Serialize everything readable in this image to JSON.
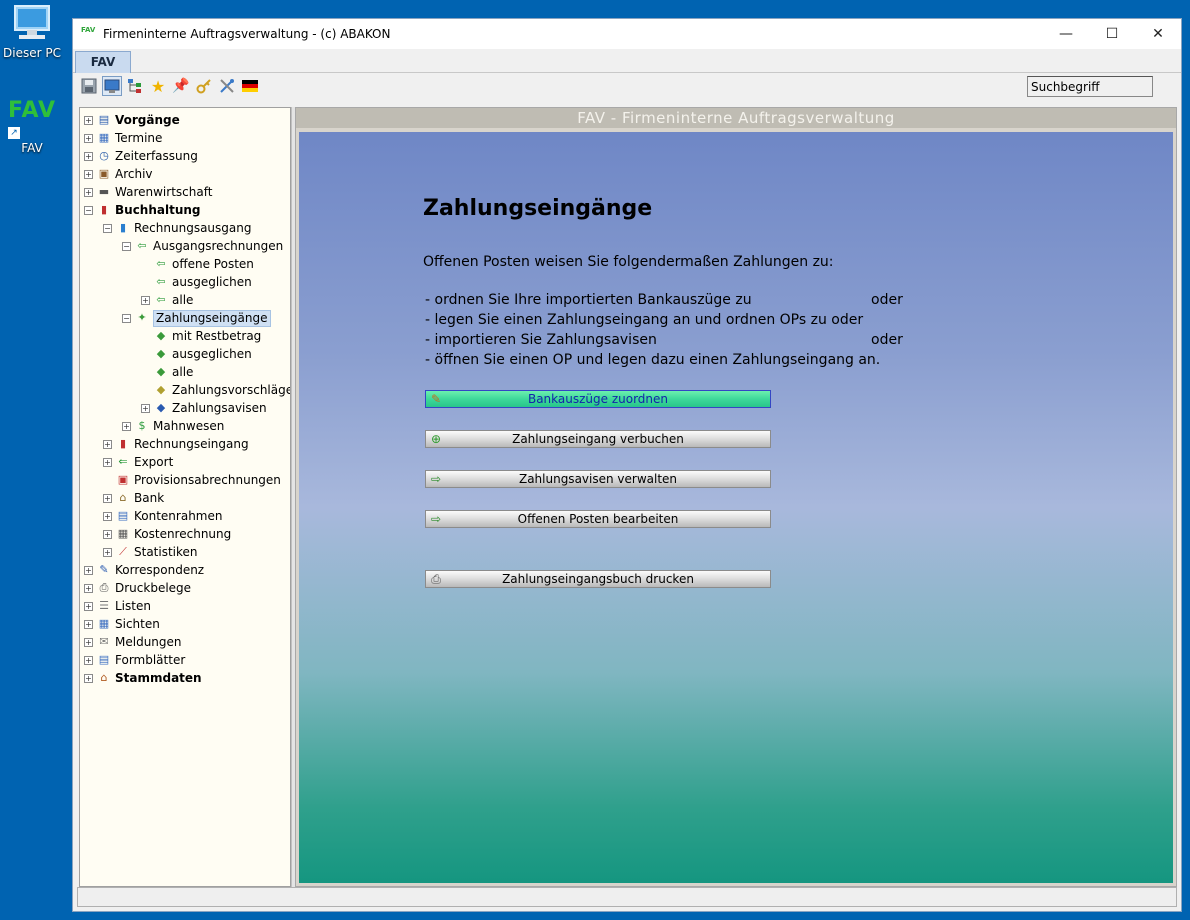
{
  "desktop": {
    "pc_label": "Dieser PC",
    "fav_logo": "FAV",
    "fav_label": "FAV"
  },
  "window": {
    "app_icon_text": "FAV",
    "title": "Firmeninterne Auftragsverwaltung - (c) ABAKON",
    "minimize": "—",
    "maximize": "☐",
    "close": "✕"
  },
  "tab": {
    "label": "FAV"
  },
  "toolbar": {
    "icons": [
      "save-icon",
      "monitor-icon",
      "tree-icon",
      "star-icon",
      "pin-icon",
      "key-icon",
      "tools-icon",
      "flag-de-icon"
    ],
    "search_value": "Suchbegriff"
  },
  "tree": [
    {
      "label": "Vorgänge",
      "bold": true,
      "level": 0,
      "exp": "+",
      "icon": "vorgaenge-icon",
      "glyph": "▤",
      "color": "#2d5fb0"
    },
    {
      "label": "Termine",
      "level": 0,
      "exp": "+",
      "icon": "calendar-icon",
      "glyph": "▦",
      "color": "#3a6dc0"
    },
    {
      "label": "Zeiterfassung",
      "level": 0,
      "exp": "+",
      "icon": "clock-icon",
      "glyph": "◷",
      "color": "#2a5ca8"
    },
    {
      "label": "Archiv",
      "level": 0,
      "exp": "+",
      "icon": "archive-icon",
      "glyph": "▣",
      "color": "#8a5a2a"
    },
    {
      "label": "Warenwirtschaft",
      "level": 0,
      "exp": "+",
      "icon": "truck-icon",
      "glyph": "▬",
      "color": "#555"
    },
    {
      "label": "Buchhaltung",
      "bold": true,
      "level": 0,
      "exp": "−",
      "icon": "chart-icon",
      "glyph": "▮",
      "color": "#c03030"
    },
    {
      "label": "Rechnungsausgang",
      "level": 1,
      "exp": "−",
      "icon": "invoice-out-icon",
      "glyph": "▮",
      "color": "#2a7fcf"
    },
    {
      "label": "Ausgangsrechnungen",
      "level": 2,
      "exp": "−",
      "icon": "invoice-list-icon",
      "glyph": "⇦",
      "color": "#2a9a3a"
    },
    {
      "label": "offene Posten",
      "level": 3,
      "exp": "",
      "icon": "open-items-icon",
      "glyph": "⇦",
      "color": "#2a9a3a"
    },
    {
      "label": "ausgeglichen",
      "level": 3,
      "exp": "",
      "icon": "balanced-icon",
      "glyph": "⇦",
      "color": "#2a9a3a"
    },
    {
      "label": "alle",
      "level": 3,
      "exp": "+",
      "icon": "all-icon",
      "glyph": "⇦",
      "color": "#2a9a3a"
    },
    {
      "label": "Zahlungseingänge",
      "level": 2,
      "exp": "−",
      "icon": "money-icon",
      "glyph": "✦",
      "color": "#3a9a3a",
      "selected": true
    },
    {
      "label": "mit Restbetrag",
      "level": 3,
      "exp": "",
      "icon": "money-rest-icon",
      "glyph": "◆",
      "color": "#3a9a3a"
    },
    {
      "label": "ausgeglichen",
      "level": 3,
      "exp": "",
      "icon": "money-balanced-icon",
      "glyph": "◆",
      "color": "#3a9a3a"
    },
    {
      "label": "alle",
      "level": 3,
      "exp": "",
      "icon": "money-all-icon",
      "glyph": "◆",
      "color": "#3a9a3a"
    },
    {
      "label": "Zahlungsvorschläge",
      "level": 3,
      "exp": "",
      "icon": "money-suggest-icon",
      "glyph": "◆",
      "color": "#b0a030"
    },
    {
      "label": "Zahlungsavisen",
      "level": 3,
      "exp": "+",
      "icon": "money-advice-icon",
      "glyph": "◆",
      "color": "#2a5ab0"
    },
    {
      "label": "Mahnwesen",
      "level": 2,
      "exp": "+",
      "icon": "dunning-icon",
      "glyph": "$",
      "color": "#2a9a3a"
    },
    {
      "label": "Rechnungseingang",
      "level": 1,
      "exp": "+",
      "icon": "invoice-in-icon",
      "glyph": "▮",
      "color": "#c03030"
    },
    {
      "label": "Export",
      "level": 1,
      "exp": "+",
      "icon": "export-icon",
      "glyph": "⇐",
      "color": "#2a9a3a"
    },
    {
      "label": "Provisionsabrechnungen",
      "level": 1,
      "exp": "",
      "icon": "commission-icon",
      "glyph": "▣",
      "color": "#c03030"
    },
    {
      "label": "Bank",
      "level": 1,
      "exp": "+",
      "icon": "bank-icon",
      "glyph": "⌂",
      "color": "#8a6a2a"
    },
    {
      "label": "Kontenrahmen",
      "level": 1,
      "exp": "+",
      "icon": "accounts-icon",
      "glyph": "▤",
      "color": "#3a6dc0"
    },
    {
      "label": "Kostenrechnung",
      "level": 1,
      "exp": "+",
      "icon": "calculator-icon",
      "glyph": "▦",
      "color": "#555"
    },
    {
      "label": "Statistiken",
      "level": 1,
      "exp": "+",
      "icon": "statistics-icon",
      "glyph": "⟋",
      "color": "#c03030"
    },
    {
      "label": "Korrespondenz",
      "level": 0,
      "exp": "+",
      "icon": "letter-icon",
      "glyph": "✎",
      "color": "#2a5ab0"
    },
    {
      "label": "Druckbelege",
      "level": 0,
      "exp": "+",
      "icon": "printer-icon",
      "glyph": "⎙",
      "color": "#555"
    },
    {
      "label": "Listen",
      "level": 0,
      "exp": "+",
      "icon": "list-icon",
      "glyph": "☰",
      "color": "#777"
    },
    {
      "label": "Sichten",
      "level": 0,
      "exp": "+",
      "icon": "views-icon",
      "glyph": "▦",
      "color": "#3a6dc0"
    },
    {
      "label": "Meldungen",
      "level": 0,
      "exp": "+",
      "icon": "mail-icon",
      "glyph": "✉",
      "color": "#777"
    },
    {
      "label": "Formblätter",
      "level": 0,
      "exp": "+",
      "icon": "forms-icon",
      "glyph": "▤",
      "color": "#3a6dc0"
    },
    {
      "label": "Stammdaten",
      "bold": true,
      "level": 0,
      "exp": "+",
      "icon": "house-icon",
      "glyph": "⌂",
      "color": "#b05a20"
    }
  ],
  "content": {
    "header": "FAV - Firmeninterne Auftragsverwaltung",
    "heading": "Zahlungseingänge",
    "intro": "Offenen Posten weisen Sie folgendermaßen Zahlungen zu:",
    "bullets": [
      "- ordnen Sie Ihre importierten Bankauszüge zu",
      "- legen Sie einen Zahlungseingang an und ordnen OPs zu oder",
      "- importieren Sie Zahlungsavisen",
      "- öffnen Sie einen OP und legen dazu einen Zahlungseingang an."
    ],
    "oder": "oder",
    "buttons": [
      {
        "label": "Bankauszüge zuordnen",
        "icon": "pencil-icon",
        "glyph": "✎",
        "color": "#c07020",
        "active": true
      },
      {
        "label": "Zahlungseingang verbuchen",
        "icon": "add-circle-icon",
        "glyph": "⊕",
        "color": "#2a9a2a"
      },
      {
        "label": "Zahlungsavisen verwalten",
        "icon": "advice-icon",
        "glyph": "⇨",
        "color": "#2a8a2a"
      },
      {
        "label": "Offenen Posten bearbeiten",
        "icon": "edit-items-icon",
        "glyph": "⇨",
        "color": "#2a8a2a"
      },
      {
        "label": "Zahlungseingangsbuch drucken",
        "icon": "print-icon",
        "glyph": "⎙",
        "color": "#555"
      }
    ]
  }
}
